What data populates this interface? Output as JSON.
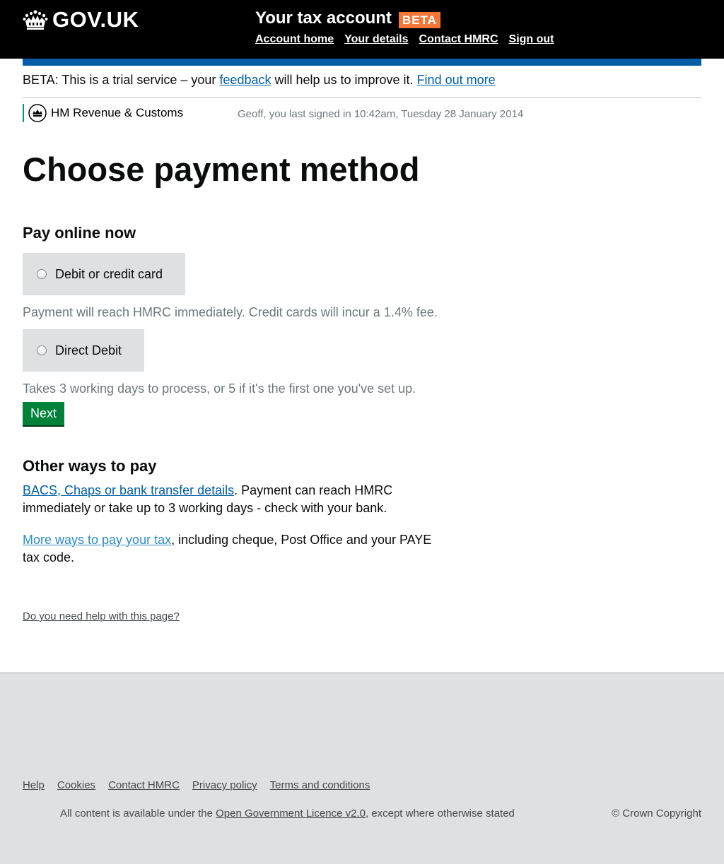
{
  "header": {
    "logo_text": "GOV.UK",
    "service_name": "Your tax account",
    "beta_tag": "BETA",
    "nav": [
      {
        "label": "Account home"
      },
      {
        "label": "Your details"
      },
      {
        "label": "Contact HMRC"
      },
      {
        "label": "Sign out"
      }
    ],
    "colors": {
      "background": "#000000",
      "blue_bar": "#005ea5",
      "beta_tag": "#f47738"
    }
  },
  "beta_banner": {
    "prefix": "BETA: This is a trial service – your ",
    "feedback_link": "feedback",
    "middle": " will help us to improve it. ",
    "find_out_more_link": "Find out more"
  },
  "hmrc": {
    "name": "HM Revenue & Customs",
    "crest_icon": "hmrc-crest-icon",
    "last_signed_in": "Geoff, you last signed in 10:42am, Tuesday 28 January 2014"
  },
  "page": {
    "title": "Choose payment method"
  },
  "pay_online": {
    "heading": "Pay online now",
    "options": [
      {
        "label": "Debit or credit card",
        "hint": "Payment will reach HMRC immediately. Credit cards will incur a 1.4% fee.",
        "selected": false
      },
      {
        "label": "Direct Debit",
        "hint": "Takes 3 working days to process, or 5 if it's the first one you've set up.",
        "selected": false
      }
    ],
    "next_button": "Next",
    "button_color": "#00823b"
  },
  "other_ways": {
    "heading": "Other ways to pay",
    "bacs_link": "BACS, Chaps or bank transfer details",
    "bacs_text": ". Payment can reach HMRC immediately or take up to 3 working days - check with your bank.",
    "more_link": "More ways to pay your tax",
    "more_text": ", including cheque, Post Office and your PAYE tax code."
  },
  "help_link": "Do you need help with this page?",
  "footer": {
    "links": [
      {
        "label": "Help"
      },
      {
        "label": "Cookies"
      },
      {
        "label": "Contact HMRC"
      },
      {
        "label": "Privacy policy"
      },
      {
        "label": "Terms and conditions"
      }
    ],
    "licence_prefix": "All content is available under the ",
    "licence_link": "Open Government Licence v2.0",
    "licence_suffix": ", except where otherwise stated",
    "copyright": "© Crown Copyright",
    "background": "#dee0e2"
  }
}
